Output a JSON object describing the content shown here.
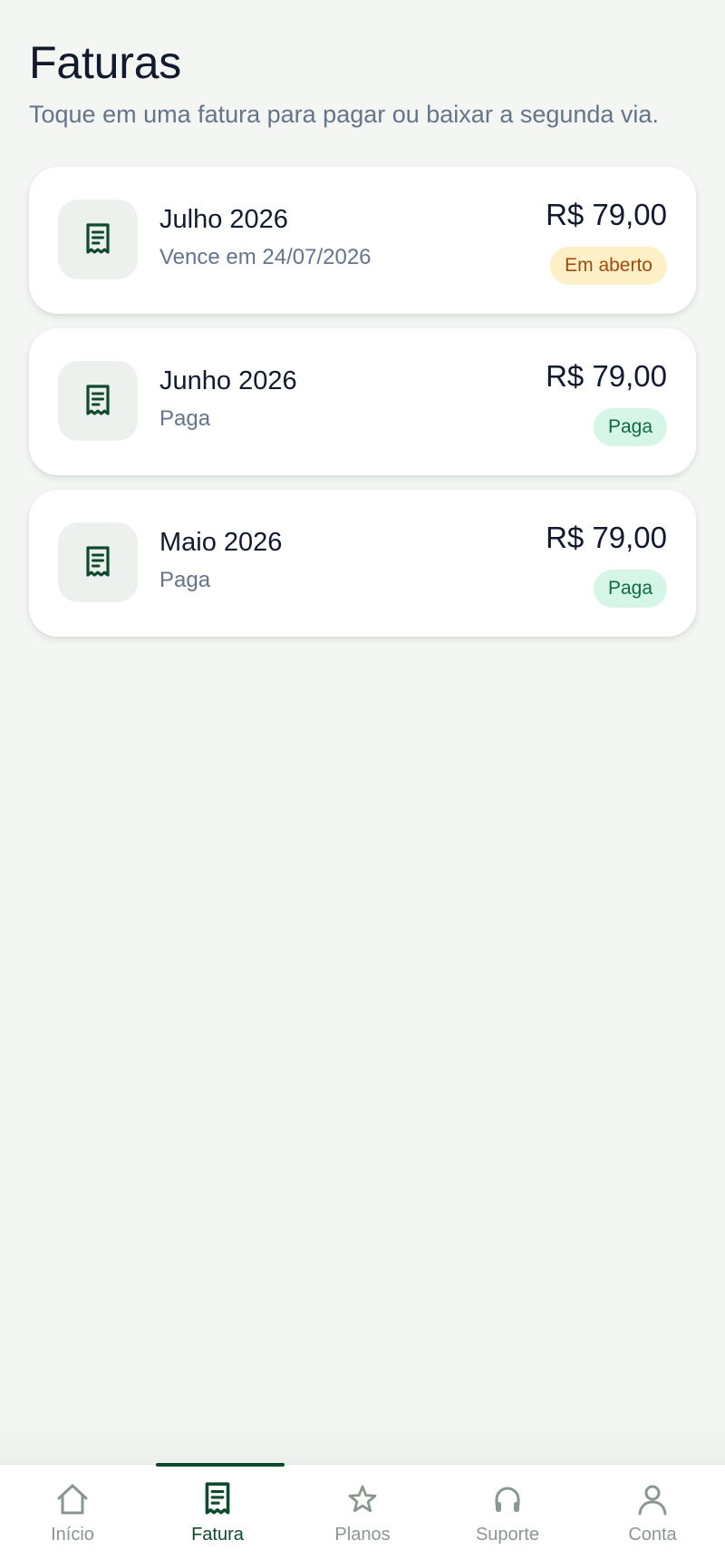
{
  "header": {
    "title": "Faturas",
    "subtitle": "Toque em uma fatura para pagar ou baixar a segunda via."
  },
  "invoices": [
    {
      "icon": "receipt-icon",
      "title": "Julho 2026",
      "subtitle": "Vence em 24/07/2026",
      "amount": "R$ 79,00",
      "status": "Em aberto",
      "status_color": "#a14a0b",
      "status_bg": "#fdf0c7"
    },
    {
      "icon": "receipt-icon",
      "title": "Junho 2026",
      "subtitle": "Paga",
      "amount": "R$ 79,00",
      "status": "Paga",
      "status_color": "#0c6a44",
      "status_bg": "#d5f6e6"
    },
    {
      "icon": "receipt-icon",
      "title": "Maio 2026",
      "subtitle": "Paga",
      "amount": "R$ 79,00",
      "status": "Paga",
      "status_color": "#0c6a44",
      "status_bg": "#d5f6e6"
    }
  ],
  "nav": {
    "items": [
      {
        "icon": "home-icon",
        "label": "Início",
        "active": false
      },
      {
        "icon": "receipt-icon",
        "label": "Fatura",
        "active": true
      },
      {
        "icon": "star-icon",
        "label": "Planos",
        "active": false
      },
      {
        "icon": "headphones-icon",
        "label": "Suporte",
        "active": false
      },
      {
        "icon": "user-icon",
        "label": "Conta",
        "active": false
      }
    ]
  },
  "colors": {
    "accent": "#0f4a2c",
    "background": "#f3f6f3",
    "text_primary": "#111a2e",
    "text_secondary": "#64748b",
    "nav_inactive": "#8a978d"
  }
}
